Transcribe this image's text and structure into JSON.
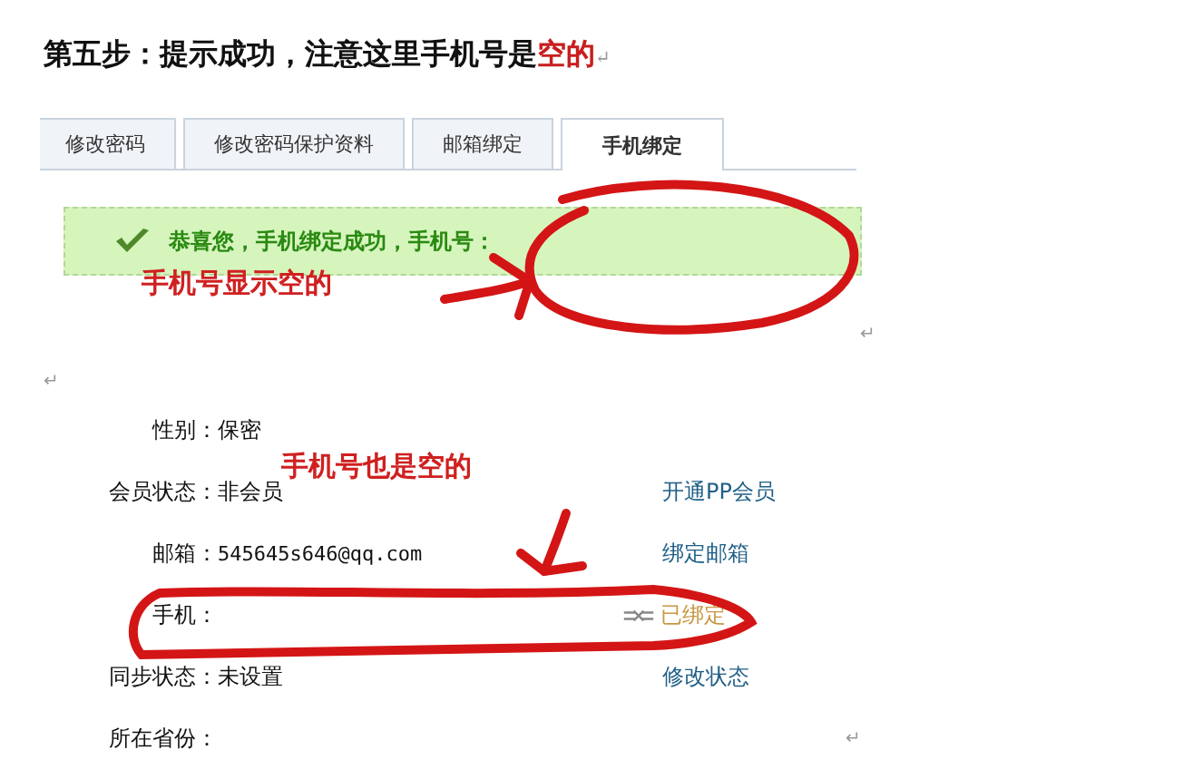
{
  "title": {
    "text": "第五步：提示成功，注意这里手机号是",
    "highlight": "空的",
    "mark": "↵"
  },
  "tabs": [
    {
      "label": "修改密码",
      "selected": false
    },
    {
      "label": "修改密码保护资料",
      "selected": false
    },
    {
      "label": "邮箱绑定",
      "selected": false
    },
    {
      "label": "手机绑定",
      "selected": true
    }
  ],
  "banner": {
    "message": "恭喜您，手机绑定成功，手机号："
  },
  "annotations": [
    {
      "text": "手机号显示空的"
    },
    {
      "text": "手机号也是空的"
    }
  ],
  "paragraph_marks": [
    "↵",
    "↵",
    "↵"
  ],
  "profile": [
    {
      "label": "性别：",
      "value": "保密"
    },
    {
      "label": "会员状态：",
      "value": "非会员",
      "action": "开通PP会员",
      "kind": "link"
    },
    {
      "label": "邮箱：",
      "value": "545645s646@qq.com",
      "mono": true,
      "action": "绑定邮箱",
      "kind": "link"
    },
    {
      "label": "手机：",
      "action": "已绑定",
      "kind": "status"
    },
    {
      "label": "同步状态：",
      "value": "未设置",
      "action": "修改状态",
      "kind": "link"
    },
    {
      "label": "所在省份："
    }
  ]
}
